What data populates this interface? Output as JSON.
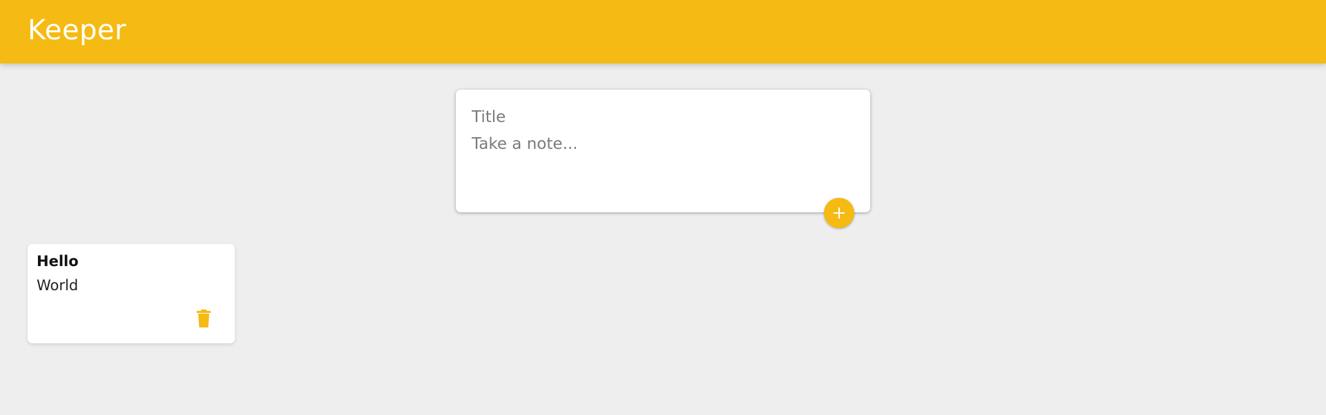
{
  "header": {
    "title": "Keeper",
    "background_color": "#f5ba13"
  },
  "create_area": {
    "title_placeholder": "Title",
    "content_placeholder": "Take a note...",
    "add_button_icon": "plus-icon",
    "add_button_color": "#f5ba13"
  },
  "notes": [
    {
      "title": "Hello",
      "content": "World",
      "delete_icon": "trash-icon"
    }
  ],
  "colors": {
    "accent": "#f5ba13",
    "background": "#eeeeee",
    "card": "#ffffff"
  }
}
